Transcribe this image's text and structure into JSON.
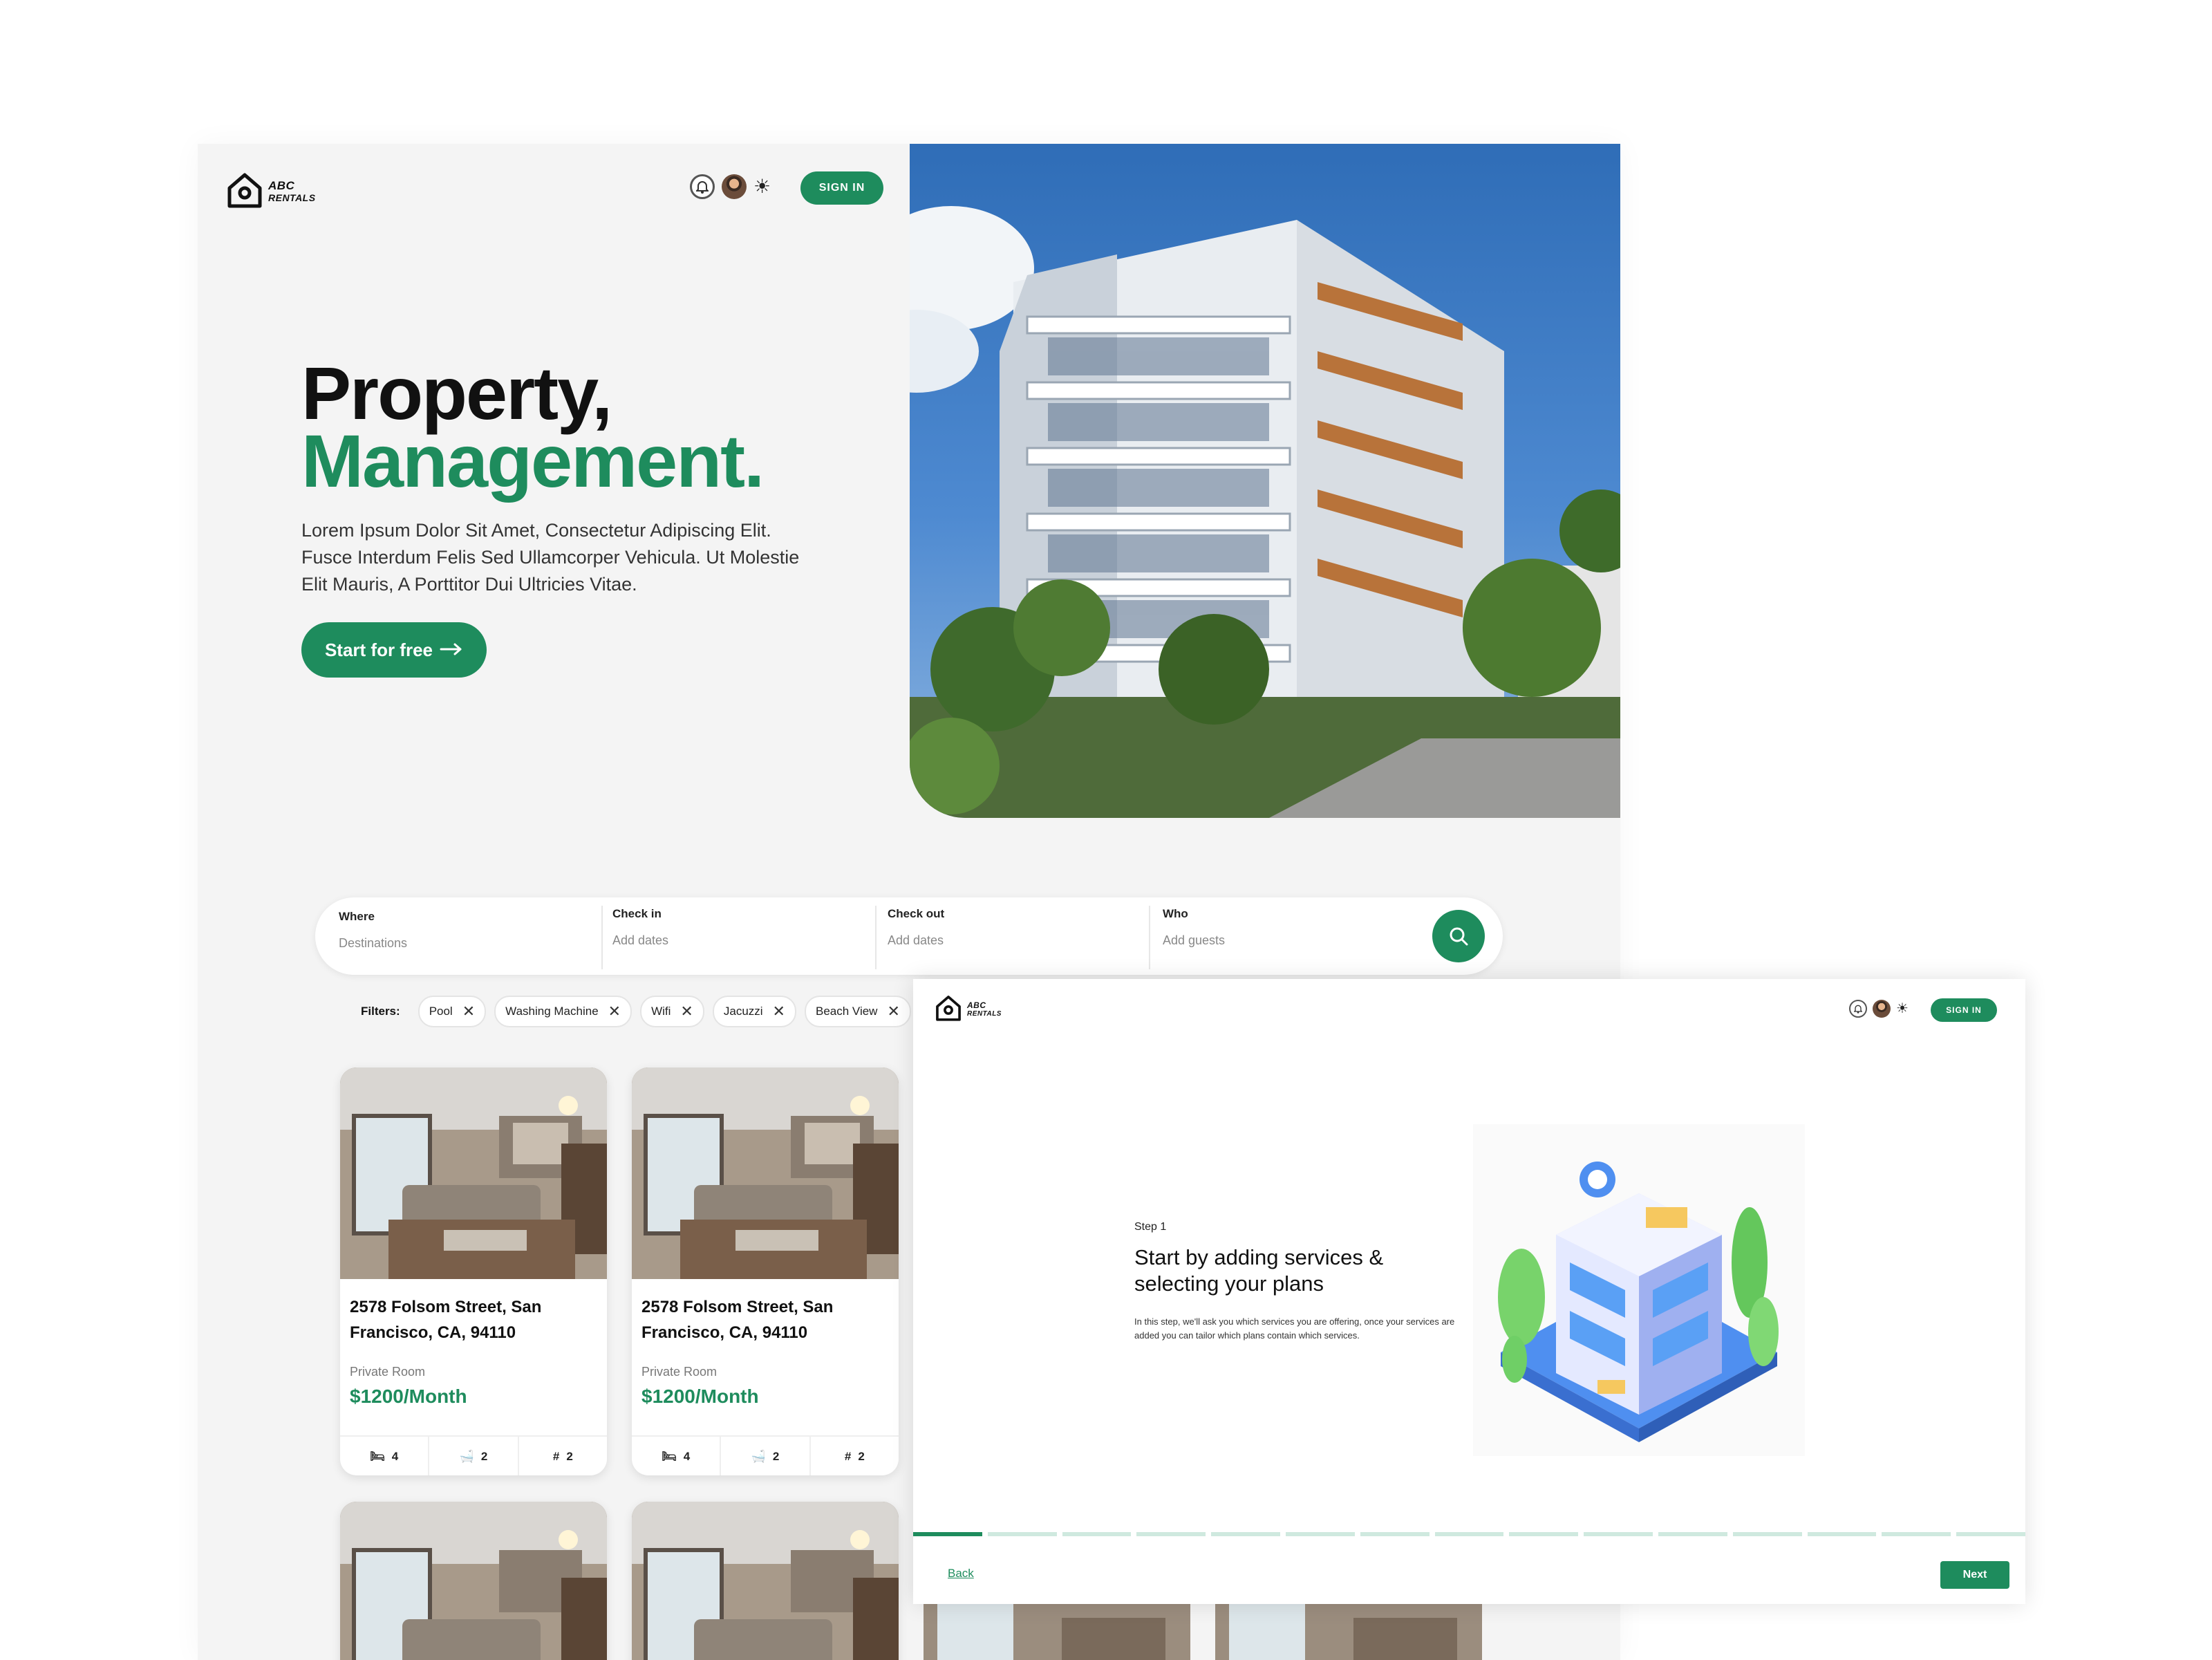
{
  "brand": {
    "line1": "ABC",
    "line2": "RENTALS"
  },
  "header": {
    "sign_in": "SIGN IN",
    "icons": [
      "bell-icon",
      "avatar",
      "sun-icon"
    ]
  },
  "hero": {
    "title_line1": "Property,",
    "title_line2": "Management.",
    "description": "Lorem Ipsum Dolor Sit Amet, Consectetur Adipiscing Elit. Fusce Interdum Felis Sed Ullamcorper Vehicula. Ut Molestie Elit Mauris, A Porttitor Dui Ultricies Vitae.",
    "cta": "Start for free"
  },
  "search": {
    "fields": [
      {
        "label": "Where",
        "placeholder": "Destinations"
      },
      {
        "label": "Check in",
        "placeholder": "Add dates"
      },
      {
        "label": "Check out",
        "placeholder": "Add dates"
      },
      {
        "label": "Who",
        "placeholder": "Add guests"
      }
    ]
  },
  "filters": {
    "label": "Filters:",
    "chips": [
      "Pool",
      "Washing Machine",
      "Wifi",
      "Jacuzzi",
      "Beach View"
    ]
  },
  "listings": [
    {
      "address": "2578 Folsom Street, San Francisco, CA, 94110",
      "type": "Private Room",
      "price": "$1200/Month",
      "beds": "4",
      "baths": "2",
      "area": "2"
    },
    {
      "address": "2578 Folsom Street, San Francisco, CA, 94110",
      "type": "Private Room",
      "price": "$1200/Month",
      "beds": "4",
      "baths": "2",
      "area": "2"
    }
  ],
  "onboarding": {
    "sign_in": "SIGN IN",
    "step": "Step 1",
    "title": "Start by adding services & selecting your plans",
    "description": "In this step, we'll ask you which services you are offering, once your services are added you can tailor which plans contain which services.",
    "progress": {
      "current": 1,
      "total": 15
    },
    "back": "Back",
    "next": "Next"
  },
  "colors": {
    "accent": "#1e8c5d",
    "page_bg": "#f4f4f4",
    "card_bg": "#ffffff"
  }
}
